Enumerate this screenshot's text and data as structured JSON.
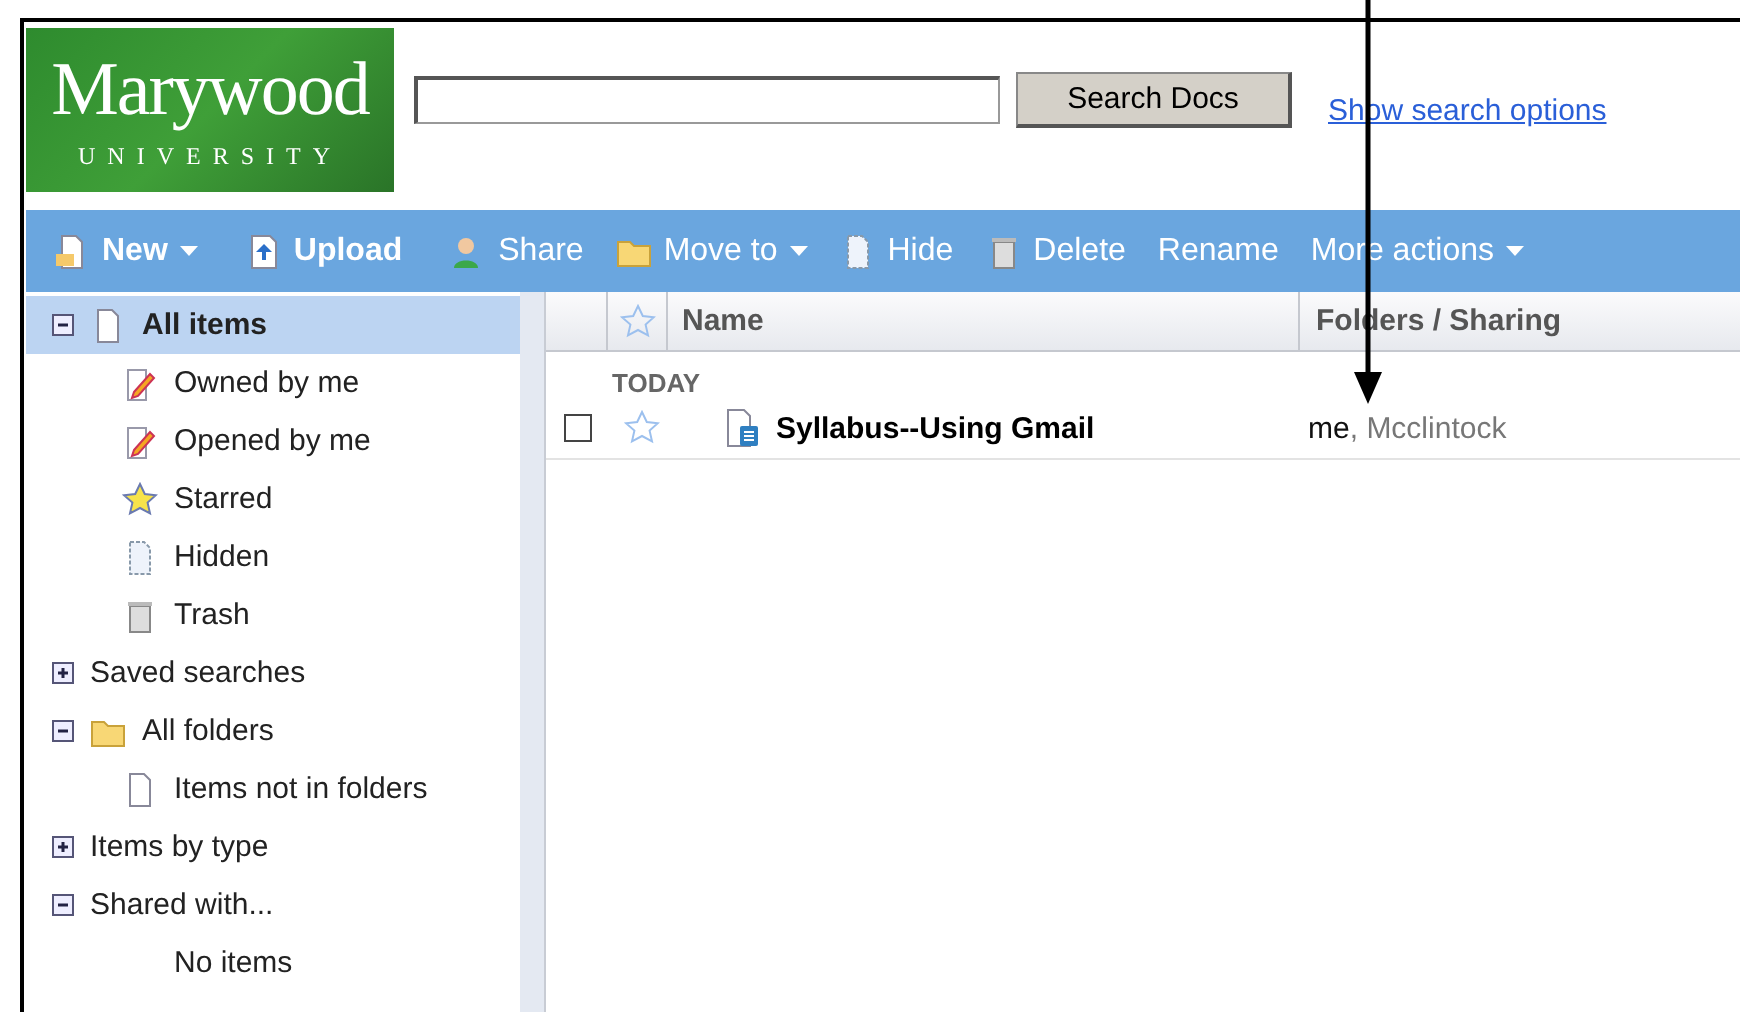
{
  "logo": {
    "name": "Marywood",
    "subtitle": "UNIVERSITY"
  },
  "search": {
    "button": "Search Docs",
    "link": "Show search options"
  },
  "toolbar": [
    {
      "label": "New",
      "kind": "new",
      "bold": true,
      "dropdown": true
    },
    {
      "label": "Upload",
      "kind": "upload",
      "bold": true,
      "dropdown": false
    },
    {
      "label": "Share",
      "kind": "share",
      "bold": false,
      "dropdown": false
    },
    {
      "label": "Move to",
      "kind": "folder",
      "bold": false,
      "dropdown": true
    },
    {
      "label": "Hide",
      "kind": "hidden",
      "bold": false,
      "dropdown": false
    },
    {
      "label": "Delete",
      "kind": "trash",
      "bold": false,
      "dropdown": false
    },
    {
      "label": "Rename",
      "kind": "none",
      "bold": false,
      "dropdown": false
    },
    {
      "label": "More actions",
      "kind": "none",
      "bold": false,
      "dropdown": true
    }
  ],
  "sidebar": [
    {
      "label": "All items",
      "kind": "doc",
      "expanded": true,
      "selected": true,
      "children": [
        {
          "label": "Owned by me",
          "kind": "pencil",
          "selected": false
        },
        {
          "label": "Opened by me",
          "kind": "pencil",
          "selected": false
        },
        {
          "label": "Starred",
          "kind": "star",
          "selected": false
        },
        {
          "label": "Hidden",
          "kind": "hidden",
          "selected": false
        },
        {
          "label": "Trash",
          "kind": "trash",
          "selected": false
        }
      ]
    },
    {
      "label": "Saved searches",
      "kind": "none",
      "expanded": false,
      "selected": false
    },
    {
      "label": "All folders",
      "kind": "folder",
      "expanded": true,
      "selected": false,
      "children": [
        {
          "label": "Items not in folders",
          "kind": "doc",
          "selected": false
        }
      ]
    },
    {
      "label": "Items by type",
      "kind": "none",
      "expanded": false,
      "selected": false
    },
    {
      "label": "Shared with...",
      "kind": "none",
      "expanded": true,
      "selected": false,
      "children": [
        {
          "label": "No items",
          "kind": "none",
          "selected": false
        }
      ]
    }
  ],
  "table": {
    "columns": [
      "Name",
      "Folders / Sharing"
    ],
    "groups": [
      {
        "title": "TODAY",
        "rows": [
          {
            "checked": false,
            "starred": false,
            "name": "Syllabus--Using Gmail",
            "owner": "me",
            "separator": ",",
            "shared_with": "Mcclintock"
          }
        ]
      }
    ]
  }
}
